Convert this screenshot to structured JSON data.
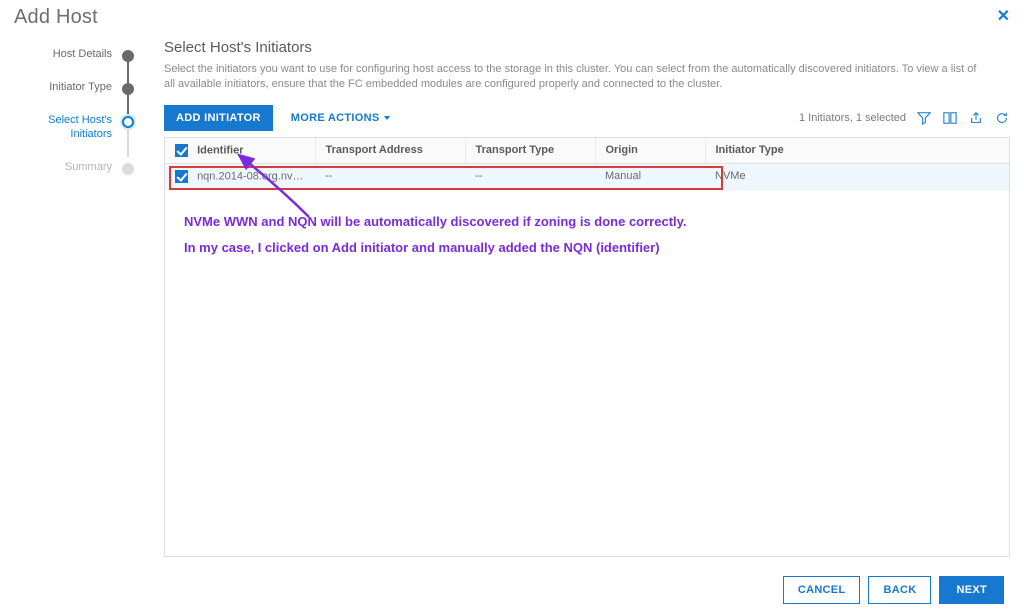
{
  "header": {
    "title": "Add Host"
  },
  "stepper": {
    "steps": [
      {
        "label": "Host Details",
        "state": "done"
      },
      {
        "label": "Initiator Type",
        "state": "done"
      },
      {
        "label": "Select Host's Initiators",
        "state": "active"
      },
      {
        "label": "Summary",
        "state": "pending"
      }
    ]
  },
  "section": {
    "title": "Select Host's Initiators",
    "description": "Select the initiators you want to use for configuring host access to the storage in this cluster. You can select from the automatically discovered initiators. To view a list of all available initiators, ensure that the FC embedded modules are configured properly and connected to the cluster."
  },
  "toolbar": {
    "add_label": "ADD INITIATOR",
    "more_label": "MORE ACTIONS",
    "status_text": "1 Initiators, 1 selected"
  },
  "table": {
    "columns": [
      "Identifier",
      "Transport Address",
      "Transport Type",
      "Origin",
      "Initiator Type"
    ],
    "rows": [
      {
        "identifier": "nqn.2014-08.org.nvm...",
        "transport_address": "--",
        "transport_type": "--",
        "origin": "Manual",
        "initiator_type": "NVMe",
        "checked": true
      }
    ]
  },
  "annotation": {
    "line1": "NVMe WWN and NQN will be automatically discovered if zoning is done correctly.",
    "line2": "In my case, I clicked on Add initiator and manually added the NQN (identifier)"
  },
  "footer": {
    "cancel": "CANCEL",
    "back": "BACK",
    "next": "NEXT"
  }
}
